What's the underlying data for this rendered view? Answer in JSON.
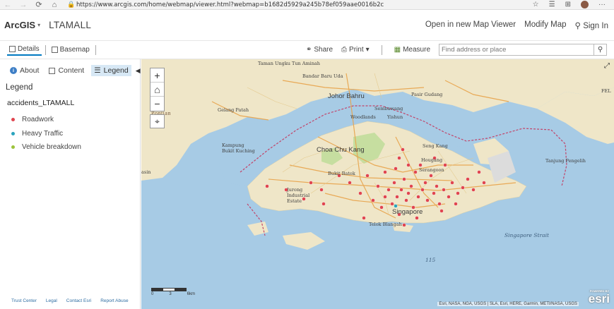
{
  "browser": {
    "url": "https://www.arcgis.com/home/webmap/viewer.html?webmap=b1682d5929a245b78ef059aae0016b2c"
  },
  "header": {
    "brand": "ArcGIS",
    "map_title": "LTAMALL",
    "open_viewer": "Open in new Map Viewer",
    "modify_map": "Modify Map",
    "sign_in": "Sign In"
  },
  "toolbar": {
    "details": "Details",
    "basemap": "Basemap",
    "share": "Share",
    "print": "Print",
    "measure": "Measure",
    "search_placeholder": "Find address or place"
  },
  "panel": {
    "tabs": [
      "About",
      "Content",
      "Legend"
    ],
    "legend_title": "Legend",
    "layer": "accidents_LTAMALL",
    "items": [
      {
        "label": "Roadwork",
        "color": "#e0454f"
      },
      {
        "label": "Heavy Traffic",
        "color": "#2aa3bd"
      },
      {
        "label": "Vehicle breakdown",
        "color": "#9cc33b"
      }
    ],
    "footer": [
      "Trust Center",
      "Legal",
      "Contact Esri",
      "Report Abuse"
    ]
  },
  "map": {
    "labels": [
      "Taman Ungku Tun Aminah",
      "Bandar Baru Uda",
      "Johor Bahru",
      "Pasir Gudang",
      "Sembawang",
      "Woodlands",
      "Yishun",
      "Gelang Patah",
      "Pontian",
      "Kampung Bukit Kuching",
      "Choa Chu Kang",
      "Seng Kang",
      "Hougang",
      "Serangoon",
      "Bukit Batok",
      "Jurong Industrial Estate",
      "Singapore",
      "Telok Blangah",
      "Tanjung Pengelih",
      "Singapore Strait",
      "115",
      "FEL",
      "asin"
    ],
    "scale": [
      "0",
      "3",
      "6km"
    ],
    "attribution": "Esri, NASA, NGA, USGS | SLA, Esri, HERE, Garmin, METI/NASA, USGS",
    "esri": "esri",
    "esri_powered": "POWERED BY"
  }
}
